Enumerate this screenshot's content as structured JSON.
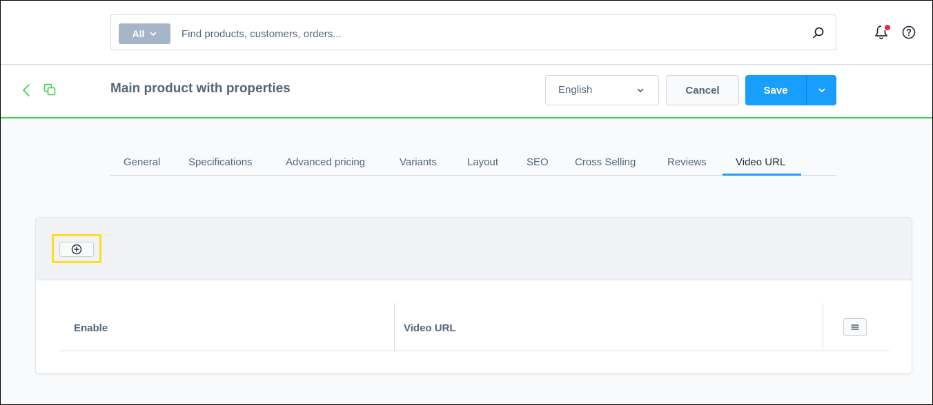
{
  "search": {
    "type_label": "All",
    "placeholder": "Find products, customers, orders..."
  },
  "header": {
    "title": "Main product with properties",
    "language": "English",
    "cancel_label": "Cancel",
    "save_label": "Save"
  },
  "tabs": [
    {
      "label": "General"
    },
    {
      "label": "Specifications"
    },
    {
      "label": "Advanced pricing"
    },
    {
      "label": "Variants"
    },
    {
      "label": "Layout"
    },
    {
      "label": "SEO"
    },
    {
      "label": "Cross Selling"
    },
    {
      "label": "Reviews"
    },
    {
      "label": "Video URL",
      "active": true
    }
  ],
  "grid": {
    "columns": [
      {
        "label": "Enable"
      },
      {
        "label": "Video URL"
      }
    ]
  },
  "icons": {
    "search": "search-icon",
    "notifications": "bell-icon",
    "help": "help-icon",
    "back": "chevron-left-icon",
    "copy": "copy-icon",
    "add": "plus-circle-icon",
    "grid_settings": "menu-lines-icon"
  },
  "colors": {
    "primary": "#189eff",
    "accent_line": "#37d046",
    "notification_dot": "#de294c",
    "highlight": "#f7e21b"
  }
}
